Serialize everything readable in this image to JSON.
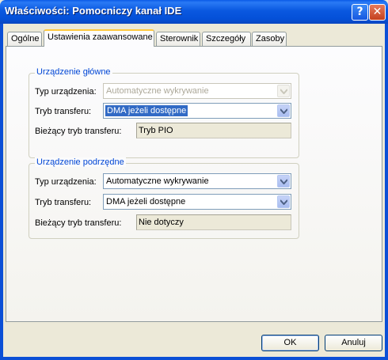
{
  "window": {
    "title": "Właściwości: Pomocniczy kanał IDE",
    "help_label": "?",
    "close_label": "✕"
  },
  "tabs": [
    {
      "label": "Ogólne"
    },
    {
      "label": "Ustawienia zaawansowane"
    },
    {
      "label": "Sterownik"
    },
    {
      "label": "Szczegóły"
    },
    {
      "label": "Zasoby"
    }
  ],
  "primary": {
    "title": "Urządzenie główne",
    "device_type_label": "Typ urządzenia:",
    "device_type_value": "Automatyczne wykrywanie",
    "transfer_mode_label": "Tryb transferu:",
    "transfer_mode_value": "DMA jeżeli dostępne",
    "current_mode_label": "Bieżący tryb transferu:",
    "current_mode_value": "Tryb PIO"
  },
  "secondary": {
    "title": "Urządzenie podrzędne",
    "device_type_label": "Typ urządzenia:",
    "device_type_value": "Automatyczne wykrywanie",
    "transfer_mode_label": "Tryb transferu:",
    "transfer_mode_value": "DMA jeżeli dostępne",
    "current_mode_label": "Bieżący tryb transferu:",
    "current_mode_value": "Nie dotyczy"
  },
  "buttons": {
    "ok": "OK",
    "cancel": "Anuluj"
  }
}
